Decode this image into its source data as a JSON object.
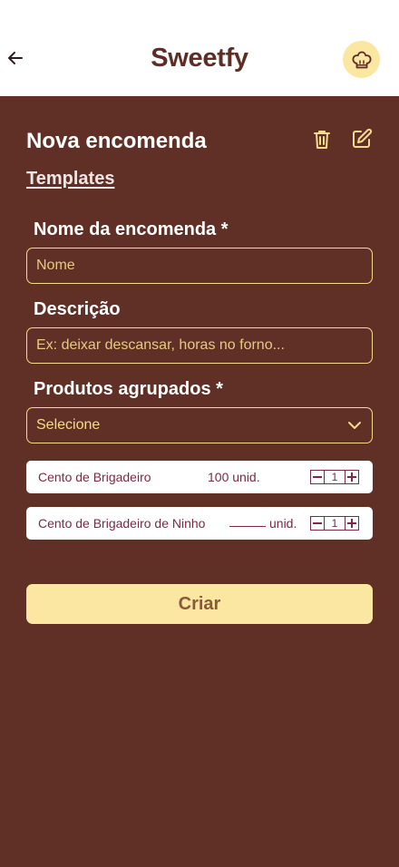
{
  "header": {
    "title": "Sweetfy",
    "back_icon": "arrow-left-icon",
    "avatar_icon": "chef-hat-icon"
  },
  "form": {
    "title": "Nova encomenda",
    "templates_link": "Templates",
    "name_label": "Nome da encomenda *",
    "name_placeholder": "Nome",
    "name_value": "",
    "description_label": "Descrição",
    "description_placeholder": "Ex: deixar descansar, horas no forno...",
    "description_value": "",
    "products_label": "Produtos agrupados *",
    "products_select_value": "Selecione",
    "products": [
      {
        "name": "Cento de Brigadeiro",
        "quantity": "100",
        "unit": "unid.",
        "count": "1"
      },
      {
        "name": "Cento de Brigadeiro de Ninho",
        "quantity": "",
        "unit": "unid.",
        "count": "1"
      }
    ],
    "submit_label": "Criar"
  },
  "colors": {
    "brand_brown": "#5E2E26",
    "background": "#603026",
    "accent_yellow": "#FBE6A2",
    "input_border": "#F5DB8C",
    "product_text": "#7D2845"
  }
}
